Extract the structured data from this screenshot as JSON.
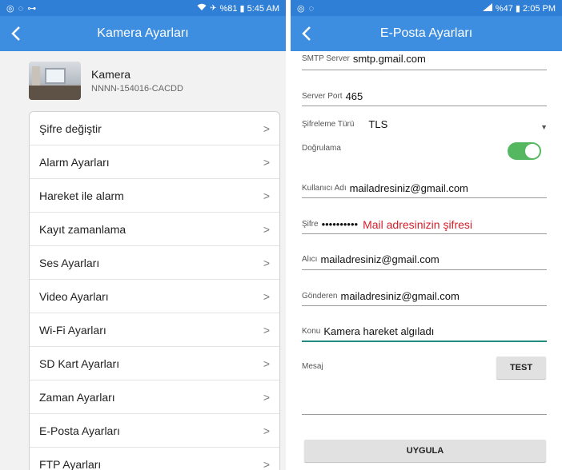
{
  "left": {
    "status": {
      "left_icons": "◎ ◌ ⊶",
      "right_text": "%81 ▮ 5:45 AM"
    },
    "app_bar": {
      "title": "Kamera Ayarları"
    },
    "camera": {
      "name": "Kamera",
      "id": "NNNN-154016-CACDD"
    },
    "menu": [
      {
        "label": "Şifre değiştir",
        "name": "menu-item-change-password"
      },
      {
        "label": "Alarm Ayarları",
        "name": "menu-item-alarm-settings"
      },
      {
        "label": "Hareket ile alarm",
        "name": "menu-item-motion-alarm"
      },
      {
        "label": "Kayıt zamanlama",
        "name": "menu-item-record-schedule"
      },
      {
        "label": "Ses Ayarları",
        "name": "menu-item-audio-settings"
      },
      {
        "label": "Video Ayarları",
        "name": "menu-item-video-settings"
      },
      {
        "label": "Wi-Fi Ayarları",
        "name": "menu-item-wifi-settings"
      },
      {
        "label": "SD Kart Ayarları",
        "name": "menu-item-sd-card-settings"
      },
      {
        "label": "Zaman Ayarları",
        "name": "menu-item-time-settings"
      },
      {
        "label": "E-Posta Ayarları",
        "name": "menu-item-email-settings"
      },
      {
        "label": "FTP Ayarları",
        "name": "menu-item-ftp-settings"
      }
    ],
    "chevron": ">"
  },
  "right": {
    "status": {
      "left_icons": "◎ ◌",
      "right_text": "%47 ▮ 2:05 PM"
    },
    "app_bar": {
      "title": "E-Posta Ayarları"
    },
    "smtp": {
      "label": "SMTP Server",
      "value": "smtp.gmail.com"
    },
    "port": {
      "label": "Server Port",
      "value": "465"
    },
    "encryption": {
      "label": "Şifreleme Türü",
      "value": "TLS",
      "arrow": "▼"
    },
    "auth": {
      "label": "Doğrulama",
      "enabled": true
    },
    "username": {
      "label": "Kullanıcı Adı",
      "value": "mailadresiniz@gmail.com"
    },
    "password": {
      "label": "Şifre",
      "value": "••••••••••",
      "note": "Mail adresinizin şifresi"
    },
    "recipient": {
      "label": "Alıcı",
      "value": "mailadresiniz@gmail.com"
    },
    "sender": {
      "label": "Gönderen",
      "value": "mailadresiniz@gmail.com"
    },
    "subject": {
      "label": "Konu",
      "value": "Kamera hareket algıladı"
    },
    "message": {
      "label": "Mesaj",
      "value": ""
    },
    "test_button": "TEST",
    "apply_button": "UYGULA"
  },
  "colors": {
    "status_bar": "#2f7fd6",
    "app_bar": "#3d8ee0",
    "toggle_on": "#55b760",
    "active_underline": "#1f8a7e",
    "note_red": "#d21f2a"
  }
}
